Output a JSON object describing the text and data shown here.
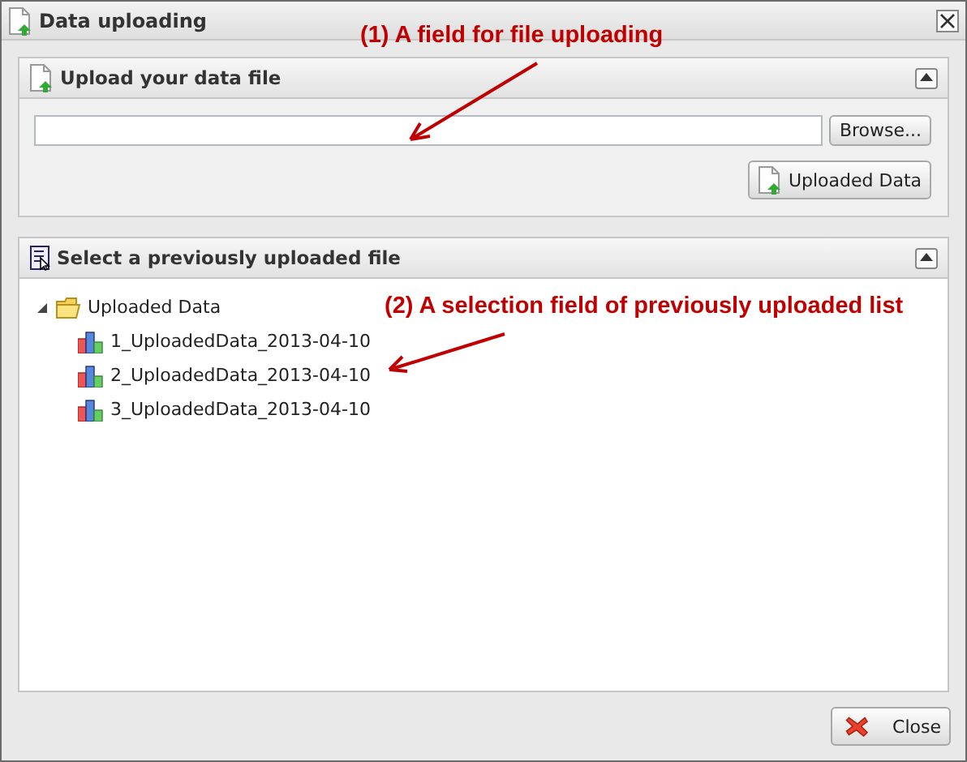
{
  "window": {
    "title": "Data uploading"
  },
  "upload_panel": {
    "title": "Upload your data file",
    "collapsed": false,
    "browse_button": "Browse...",
    "uploaded_button": "Uploaded Data"
  },
  "select_panel": {
    "title": "Select a previously uploaded file",
    "collapsed": false,
    "tree": [
      {
        "label": "Uploaded Data",
        "expanded": true,
        "children": [
          {
            "label": "1_UploadedData_2013-04-10"
          },
          {
            "label": "2_UploadedData_2013-04-10"
          },
          {
            "label": "3_UploadedData_2013-04-10"
          }
        ]
      }
    ]
  },
  "annotations": [
    {
      "text": "(1) A field for file uploading"
    },
    {
      "text": "(2) A selection field of previously uploaded list"
    }
  ],
  "footer": {
    "close_button": "Close"
  }
}
